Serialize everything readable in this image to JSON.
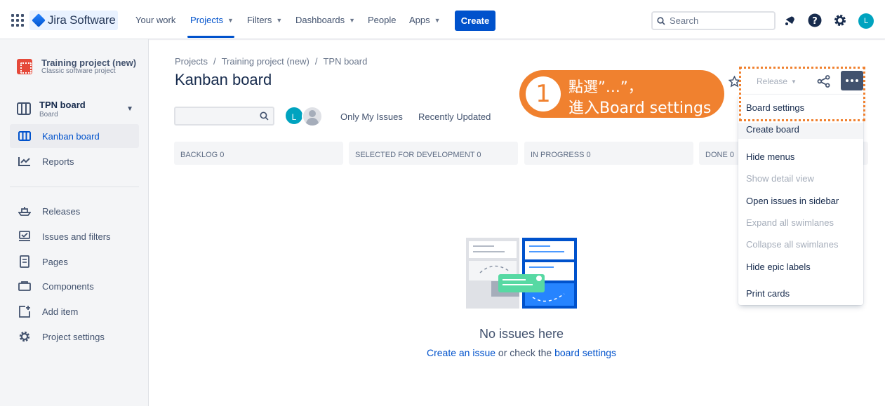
{
  "topnav": {
    "logo_text": "Jira Software",
    "items": [
      {
        "label": "Your work"
      },
      {
        "label": "Projects"
      },
      {
        "label": "Filters"
      },
      {
        "label": "Dashboards"
      },
      {
        "label": "People"
      },
      {
        "label": "Apps"
      }
    ],
    "create_label": "Create",
    "search_placeholder": "Search",
    "avatar_initial": "L"
  },
  "sidebar": {
    "project_name": "Training project (new)",
    "project_type": "Classic software project",
    "board_name": "TPN board",
    "board_sub": "Board",
    "items": [
      {
        "label": "Kanban board"
      },
      {
        "label": "Reports"
      },
      {
        "label": "Releases"
      },
      {
        "label": "Issues and filters"
      },
      {
        "label": "Pages"
      },
      {
        "label": "Components"
      },
      {
        "label": "Add item"
      },
      {
        "label": "Project settings"
      }
    ]
  },
  "main": {
    "breadcrumb": [
      "Projects",
      "/",
      "Training project (new)",
      "/",
      "TPN board"
    ],
    "title": "Kanban board",
    "avatar_initial": "L",
    "quick_filters": [
      "Only My Issues",
      "Recently Updated"
    ],
    "columns": [
      {
        "name": "BACKLOG",
        "count": "0"
      },
      {
        "name": "SELECTED FOR DEVELOPMENT",
        "count": "0"
      },
      {
        "name": "IN PROGRESS",
        "count": "0"
      },
      {
        "name": "DONE",
        "count": "0"
      }
    ],
    "empty_title": "No issues here",
    "empty_link1": "Create an issue",
    "empty_middle": " or check the ",
    "empty_link2": "board settings"
  },
  "toolbar": {
    "release_label": "Release"
  },
  "dropdown": {
    "items": [
      {
        "label": "Board settings",
        "disabled": false
      },
      {
        "label": "Create board",
        "disabled": false
      },
      {
        "label": "Hide menus",
        "disabled": false
      },
      {
        "label": "Show detail view",
        "disabled": true
      },
      {
        "label": "Open issues in sidebar",
        "disabled": false
      },
      {
        "label": "Expand all swimlanes",
        "disabled": true
      },
      {
        "label": "Collapse all swimlanes",
        "disabled": true
      },
      {
        "label": "Hide epic labels",
        "disabled": false
      },
      {
        "label": "Print cards",
        "disabled": false
      }
    ]
  },
  "callout": {
    "number": "1",
    "line1": "點選”…”，",
    "line2": "進入Board settings"
  },
  "colors": {
    "accent": "#0052CC",
    "callout": "#F0812F",
    "sidebar_bg": "#F4F5F7"
  }
}
